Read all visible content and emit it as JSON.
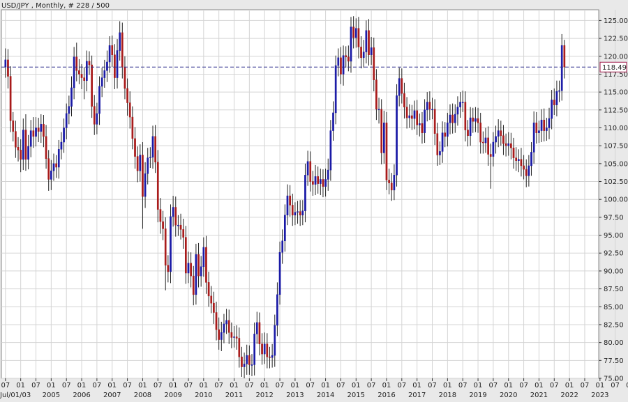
{
  "header": {
    "title": "USD/JPY , Monthly, # 228 / 500"
  },
  "colors": {
    "up": "#1a1aa6",
    "down": "#a81a1a",
    "grid": "#d4d4d4",
    "plot_bg": "#ffffff",
    "price_line": "#2a2a8c",
    "price_box": "#a01a4a"
  },
  "chart_data": {
    "type": "candlestick",
    "title": "USD/JPY , Monthly, # 228 / 500",
    "ylim": [
      75,
      126.5
    ],
    "y_ticks": [
      "125.00",
      "122.50",
      "120.00",
      "117.50",
      "115.00",
      "112.50",
      "110.00",
      "107.50",
      "105.00",
      "102.50",
      "100.00",
      "97.50",
      "95.00",
      "92.50",
      "90.00",
      "87.50",
      "85.00",
      "82.50",
      "80.00",
      "77.50",
      "75.00"
    ],
    "current_price": "118.49",
    "x_range": [
      "2003-07",
      "2022-12"
    ],
    "x_month_labels": [
      "07",
      "01",
      "07",
      "01",
      "07",
      "01",
      "07",
      "01",
      "07",
      "01",
      "07",
      "01",
      "07",
      "01",
      "07",
      "01",
      "07",
      "01",
      "07",
      "01",
      "07",
      "01",
      "07",
      "01",
      "07",
      "01",
      "07",
      "01",
      "07",
      "01",
      "07",
      "01",
      "07",
      "01",
      "07",
      "01",
      "07",
      "01",
      "07",
      "01",
      "07",
      "01"
    ],
    "x_year_labels": [
      {
        "label": "Jul/01/03",
        "month": "2003-07"
      },
      {
        "label": "2005",
        "month": "2005-01"
      },
      {
        "label": "2006",
        "month": "2006-01"
      },
      {
        "label": "2007",
        "month": "2007-01"
      },
      {
        "label": "2008",
        "month": "2008-01"
      },
      {
        "label": "2009",
        "month": "2009-01"
      },
      {
        "label": "2010",
        "month": "2010-01"
      },
      {
        "label": "2011",
        "month": "2011-01"
      },
      {
        "label": "2012",
        "month": "2012-01"
      },
      {
        "label": "2013",
        "month": "2013-01"
      },
      {
        "label": "2014",
        "month": "2014-01"
      },
      {
        "label": "2015",
        "month": "2015-01"
      },
      {
        "label": "2016",
        "month": "2016-01"
      },
      {
        "label": "2017",
        "month": "2017-01"
      },
      {
        "label": "2018",
        "month": "2018-01"
      },
      {
        "label": "2019",
        "month": "2019-01"
      },
      {
        "label": "2020",
        "month": "2020-01"
      },
      {
        "label": "2021",
        "month": "2021-01"
      },
      {
        "label": "2022",
        "month": "2022-01"
      },
      {
        "label": "2023",
        "month": "2023-01"
      }
    ],
    "start_month": "2003-07",
    "close": [
      119.5,
      117.2,
      111.0,
      109.5,
      107.3,
      106.9,
      105.6,
      109.7,
      105.6,
      107.4,
      109.6,
      108.8,
      110.0,
      109.5,
      110.5,
      108.8,
      105.7,
      102.8,
      104.0,
      105.0,
      104.5,
      107.0,
      108.0,
      110.0,
      112.0,
      113.0,
      115.6,
      119.9,
      118.0,
      117.5,
      117.0,
      116.6,
      119.3,
      118.8,
      113.0,
      110.5,
      112.0,
      115.8,
      117.0,
      118.0,
      119.2,
      121.5,
      120.2,
      117.0,
      120.8,
      123.3,
      118.5,
      115.5,
      113.5,
      111.5,
      108.5,
      106.0,
      104.0,
      106.2,
      100.4,
      103.6,
      105.8,
      105.9,
      108.8,
      105.2,
      98.6,
      96.9,
      95.9,
      90.8,
      89.9,
      97.6,
      98.9,
      96.4,
      96.4,
      95.8,
      94.7,
      89.7,
      91.1,
      89.3,
      86.7,
      92.3,
      89.3,
      90.6,
      93.3,
      88.4,
      86.5,
      85.5,
      84.2,
      81.8,
      80.4,
      81.4,
      82.6,
      83.1,
      81.4,
      80.7,
      80.8,
      80.6,
      78.0,
      76.6,
      77.0,
      78.2,
      76.9,
      76.9,
      81.2,
      82.8,
      79.8,
      78.4,
      79.8,
      78.0,
      77.9,
      78.2,
      82.4,
      86.7,
      92.6,
      94.2,
      97.8,
      100.5,
      99.2,
      97.8,
      98.2,
      98.3,
      97.8,
      98.4,
      103.4,
      105.3,
      102.5,
      102.1,
      103.2,
      102.2,
      102.8,
      101.8,
      102.8,
      104.1,
      109.6,
      112.1,
      118.7,
      119.8,
      117.5,
      120.1,
      119.9,
      119.3,
      124.1,
      122.6,
      123.9,
      121.3,
      119.8,
      120.6,
      123.6,
      120.2,
      121.2,
      116.7,
      112.6,
      112.6,
      106.5,
      110.7,
      102.7,
      102.3,
      101.3,
      103.4,
      114.5,
      116.9,
      114.8,
      112.9,
      111.4,
      111.7,
      111.3,
      112.4,
      110.4,
      110.6,
      109.3,
      112.5,
      113.6,
      112.6,
      112.6,
      109.2,
      106.2,
      106.7,
      109.3,
      108.8,
      110.7,
      111.8,
      110.7,
      111.9,
      112.9,
      113.6,
      113.6,
      109.7,
      108.9,
      111.4,
      110.9,
      111.3,
      110.7,
      108.0,
      107.9,
      108.6,
      106.3,
      106.0,
      108.0,
      108.8,
      109.6,
      108.9,
      107.8,
      107.5,
      107.8,
      107.2,
      105.8,
      105.4,
      105.6,
      104.7,
      104.2,
      103.3,
      104.7,
      106.6,
      110.7,
      109.3,
      109.6,
      111.1,
      109.6,
      110.0,
      111.3,
      113.9,
      113.2,
      115.1,
      115.2,
      121.5,
      118.5
    ],
    "high_wick": [
      1.6,
      1.5,
      1.4,
      1.2,
      1.5,
      1.4,
      1.5,
      1.6,
      2.2,
      1.6,
      1.5,
      1.9,
      1.5,
      1.4,
      1.4,
      1.3,
      1.6,
      1.2,
      1.5,
      1.4,
      1.2,
      1.3,
      1.4,
      1.3,
      1.4,
      1.5,
      1.6,
      1.4,
      2.0,
      1.6,
      1.4,
      1.5,
      1.5,
      1.4,
      1.3,
      1.6,
      1.5,
      1.4,
      1.4,
      1.5,
      1.6,
      1.3,
      1.4,
      1.5,
      1.6,
      1.6,
      1.4,
      1.5,
      1.4,
      1.6,
      1.5,
      1.6,
      1.4,
      1.5,
      1.8,
      1.6,
      1.4,
      1.4,
      1.5,
      1.6,
      1.7,
      1.6,
      1.5,
      1.6,
      1.4,
      1.7,
      1.6,
      1.5,
      1.4,
      1.6,
      1.5,
      1.6,
      1.6,
      1.5,
      1.4,
      1.5,
      1.6,
      1.5,
      1.4,
      1.6,
      1.5,
      1.4,
      1.6,
      1.5,
      1.7,
      1.5,
      1.4,
      1.6,
      1.5,
      1.4,
      1.5,
      1.6,
      1.5,
      1.4,
      1.6,
      1.5,
      1.4,
      1.5,
      1.6,
      1.5,
      1.4,
      1.5,
      1.6,
      1.5,
      1.4,
      1.6,
      1.5,
      1.7,
      1.5,
      1.6,
      1.5,
      1.6,
      1.5,
      1.6,
      1.4,
      1.5,
      1.6,
      1.5,
      1.6,
      1.5,
      1.4,
      1.5,
      1.6,
      1.4,
      1.5,
      1.4,
      1.5,
      1.6,
      1.5,
      1.6,
      1.4,
      1.3,
      1.5,
      1.4,
      1.3,
      1.6,
      1.4,
      1.5,
      1.4,
      1.6,
      1.5,
      1.7,
      1.4,
      1.6,
      1.5,
      1.4,
      1.5,
      1.6,
      1.4,
      1.7,
      1.5,
      1.6,
      1.4,
      1.5,
      1.6,
      1.5,
      1.4,
      1.5,
      1.4,
      1.6,
      1.5,
      1.4,
      1.5,
      1.4,
      1.6,
      1.5,
      1.4,
      1.5,
      1.6,
      1.4,
      1.5,
      1.4,
      1.6,
      1.5,
      1.4,
      1.5,
      1.6,
      1.4,
      1.5,
      1.4,
      1.6,
      1.5,
      1.4,
      1.5,
      1.4,
      1.6,
      1.5,
      1.4,
      1.5,
      1.4,
      1.6,
      1.5,
      1.4,
      1.5,
      1.6,
      1.4,
      1.5,
      1.4,
      1.6,
      1.5,
      1.4,
      1.5,
      1.4,
      1.6,
      1.5,
      1.4,
      1.5,
      1.4,
      1.6,
      1.5,
      1.4,
      1.5,
      1.6,
      1.4,
      1.5,
      1.4,
      1.6,
      1.5,
      1.4,
      1.6,
      0.8
    ],
    "low_wick": [
      1.5,
      1.7,
      1.6,
      1.4,
      1.5,
      1.6,
      1.8,
      1.5,
      1.6,
      1.4,
      1.5,
      1.6,
      1.4,
      1.5,
      1.6,
      1.5,
      1.4,
      1.6,
      1.5,
      1.4,
      1.5,
      1.6,
      1.4,
      1.5,
      1.6,
      1.5,
      1.4,
      1.6,
      1.5,
      1.4,
      1.6,
      2.6,
      1.5,
      1.4,
      1.6,
      1.5,
      1.4,
      1.6,
      1.5,
      1.4,
      1.6,
      1.5,
      1.7,
      1.6,
      1.5,
      1.4,
      1.6,
      1.5,
      1.8,
      1.6,
      1.5,
      1.7,
      1.6,
      1.5,
      4.5,
      1.6,
      1.5,
      1.4,
      1.6,
      1.5,
      1.8,
      1.7,
      1.6,
      3.5,
      1.5,
      1.6,
      1.4,
      1.6,
      1.5,
      1.4,
      1.6,
      1.5,
      1.4,
      1.6,
      1.5,
      1.4,
      1.6,
      1.5,
      1.4,
      1.6,
      1.5,
      1.4,
      1.6,
      1.5,
      1.4,
      1.6,
      1.5,
      1.4,
      1.6,
      1.5,
      1.4,
      1.6,
      1.5,
      1.4,
      1.6,
      1.5,
      1.4,
      1.6,
      1.5,
      1.4,
      1.6,
      1.5,
      1.4,
      1.6,
      1.5,
      1.4,
      1.6,
      1.5,
      1.4,
      1.6,
      1.5,
      1.4,
      1.6,
      1.5,
      1.4,
      1.6,
      1.5,
      1.4,
      1.6,
      1.5,
      1.4,
      1.6,
      1.5,
      1.4,
      1.6,
      1.5,
      1.4,
      1.6,
      1.5,
      1.4,
      1.6,
      1.5,
      1.4,
      1.6,
      1.5,
      1.4,
      1.6,
      1.5,
      1.4,
      1.6,
      1.5,
      1.4,
      1.6,
      1.5,
      1.4,
      1.6,
      1.5,
      2.0,
      1.6,
      1.5,
      1.4,
      1.6,
      1.5,
      1.4,
      1.6,
      1.5,
      1.4,
      1.6,
      1.5,
      1.4,
      1.6,
      1.5,
      1.4,
      1.6,
      1.5,
      1.4,
      1.6,
      1.5,
      1.4,
      1.6,
      1.5,
      1.4,
      1.6,
      1.5,
      1.4,
      1.6,
      1.5,
      1.4,
      1.6,
      1.5,
      1.4,
      1.6,
      1.5,
      1.4,
      1.6,
      1.5,
      1.4,
      1.6,
      1.5,
      1.4,
      1.6,
      4.5,
      1.4,
      1.6,
      1.5,
      1.4,
      1.6,
      1.5,
      1.4,
      1.6,
      1.5,
      1.4,
      1.6,
      1.5,
      1.4,
      1.6,
      1.5,
      1.4,
      1.6,
      1.5,
      1.4,
      1.6,
      1.5,
      1.4,
      1.6,
      1.5,
      1.4,
      1.6,
      1.5,
      1.4,
      1.6,
      1.5,
      1.4,
      1.6,
      1.5,
      1.4,
      1.6,
      1.5,
      1.4,
      1.6,
      1.5
    ]
  }
}
